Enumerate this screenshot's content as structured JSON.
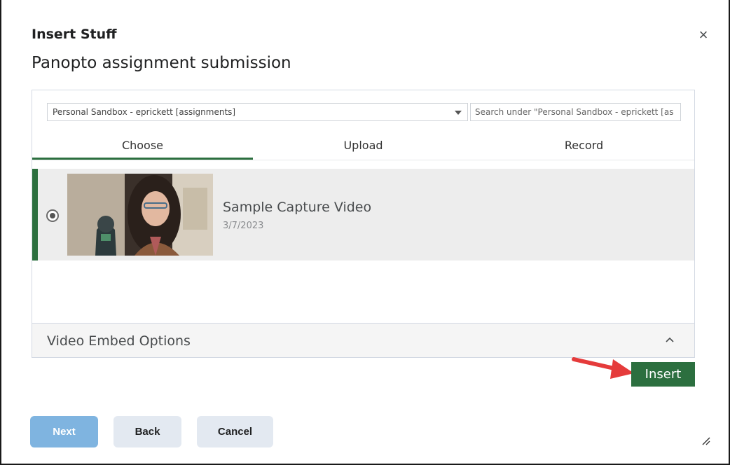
{
  "dialog": {
    "title": "Insert Stuff",
    "subtitle": "Panopto assignment submission",
    "close_glyph": "×"
  },
  "chooser": {
    "folder_value": "Personal Sandbox - eprickett [assignments]",
    "search_placeholder": "Search under \"Personal Sandbox - eprickett [as",
    "tabs": [
      {
        "label": "Choose",
        "active": true
      },
      {
        "label": "Upload",
        "active": false
      },
      {
        "label": "Record",
        "active": false
      }
    ],
    "videos": [
      {
        "title": "Sample Capture Video",
        "date": "3/7/2023",
        "selected": true
      }
    ],
    "embed_options_label": "Video Embed Options"
  },
  "actions": {
    "insert_label": "Insert",
    "next_label": "Next",
    "back_label": "Back",
    "cancel_label": "Cancel"
  },
  "colors": {
    "accent_green": "#2c6f3f",
    "next_button": "#7fb4e0",
    "secondary_button": "#e3e9f1",
    "annotation_arrow": "#e53b3b"
  },
  "icons": {
    "close": "close-icon",
    "folder_dropdown": "caret-down-icon",
    "embed_toggle": "chevron-up-icon",
    "resize": "resize-handle-icon"
  }
}
